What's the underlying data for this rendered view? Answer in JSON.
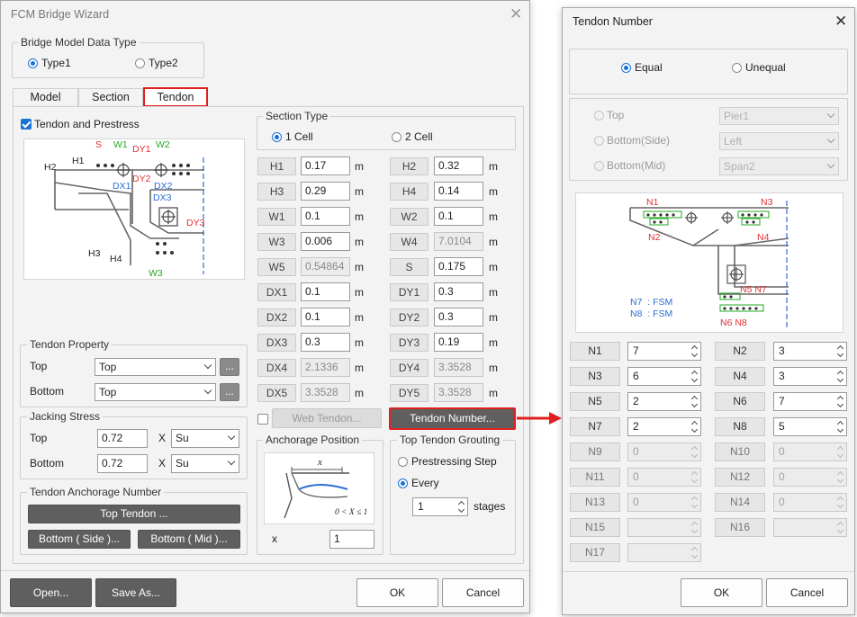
{
  "wizard": {
    "title": "FCM Bridge Wizard",
    "model_type": {
      "legend": "Bridge Model Data Type",
      "options": [
        "Type1",
        "Type2"
      ],
      "selected": "Type1"
    },
    "tabs": [
      "Model",
      "Section",
      "Tendon"
    ],
    "active_tab": "Tendon",
    "tendon_prestress_label": "Tendon and Prestress",
    "diagram_labels": {
      "S": "S",
      "W1": "W1",
      "W2": "W2",
      "W3": "W3",
      "H1": "H1",
      "H2": "H2",
      "H3": "H3",
      "H4": "H4",
      "DX1": "DX1",
      "DX2": "DX2",
      "DX3": "DX3",
      "DY1": "DY1",
      "DY2": "DY2",
      "DY3": "DY3"
    },
    "tendon_property": {
      "legend": "Tendon Property",
      "top_label": "Top",
      "top_value": "Top",
      "bottom_label": "Bottom",
      "bottom_value": "Top",
      "more": "..."
    },
    "jacking_stress": {
      "legend": "Jacking Stress",
      "top_label": "Top",
      "top_value": "0.72",
      "bottom_label": "Bottom",
      "bottom_value": "0.72",
      "x": "X",
      "top_unit": "Su",
      "bottom_unit": "Su"
    },
    "anchorage_number": {
      "legend": "Tendon Anchorage Number",
      "top_button": "Top Tendon ...",
      "bottom_side_button": "Bottom ( Side )...",
      "bottom_mid_button": "Bottom ( Mid )..."
    },
    "section_type": {
      "legend": "Section Type",
      "options": [
        "1 Cell",
        "2 Cell"
      ],
      "selected": "1 Cell"
    },
    "unit": "m",
    "params": [
      {
        "left": {
          "label": "H1",
          "value": "0.17",
          "enabled": true
        },
        "right": {
          "label": "H2",
          "value": "0.32",
          "enabled": true
        }
      },
      {
        "left": {
          "label": "H3",
          "value": "0.29",
          "enabled": true
        },
        "right": {
          "label": "H4",
          "value": "0.14",
          "enabled": true
        }
      },
      {
        "left": {
          "label": "W1",
          "value": "0.1",
          "enabled": true
        },
        "right": {
          "label": "W2",
          "value": "0.1",
          "enabled": true
        }
      },
      {
        "left": {
          "label": "W3",
          "value": "0.006",
          "enabled": true
        },
        "right": {
          "label": "W4",
          "value": "7.0104",
          "enabled": false
        }
      },
      {
        "left": {
          "label": "W5",
          "value": "0.54864",
          "enabled": false
        },
        "right": {
          "label": "S",
          "value": "0.175",
          "enabled": true
        }
      },
      {
        "left": {
          "label": "DX1",
          "value": "0.1",
          "enabled": true
        },
        "right": {
          "label": "DY1",
          "value": "0.3",
          "enabled": true
        }
      },
      {
        "left": {
          "label": "DX2",
          "value": "0.1",
          "enabled": true
        },
        "right": {
          "label": "DY2",
          "value": "0.3",
          "enabled": true
        }
      },
      {
        "left": {
          "label": "DX3",
          "value": "0.3",
          "enabled": true
        },
        "right": {
          "label": "DY3",
          "value": "0.19",
          "enabled": true
        }
      },
      {
        "left": {
          "label": "DX4",
          "value": "2.1336",
          "enabled": false
        },
        "right": {
          "label": "DY4",
          "value": "3.3528",
          "enabled": false
        }
      },
      {
        "left": {
          "label": "DX5",
          "value": "3.3528",
          "enabled": false
        },
        "right": {
          "label": "DY5",
          "value": "3.3528",
          "enabled": false
        }
      }
    ],
    "web_tendon_button": "Web Tendon...",
    "tendon_number_button": "Tendon Number...",
    "anchorage_position": {
      "legend": "Anchorage Position",
      "x_label": "x",
      "x_value": "1",
      "formula": "0 < X ≤ 1",
      "diagram_x": "x"
    },
    "grouting": {
      "legend": "Top Tendon Grouting",
      "options": [
        "Prestressing Step",
        "Every"
      ],
      "selected": "Every",
      "stages_value": "1",
      "stages_label": "stages"
    },
    "footer": {
      "open": "Open...",
      "save_as": "Save As...",
      "ok": "OK",
      "cancel": "Cancel"
    }
  },
  "tendon_dialog": {
    "title": "Tendon Number",
    "mode": {
      "options": [
        "Equal",
        "Unequal"
      ],
      "selected": "Equal"
    },
    "locations": [
      {
        "label": "Top",
        "value": "Pier1"
      },
      {
        "label": "Bottom(Side)",
        "value": "Left"
      },
      {
        "label": "Bottom(Mid)",
        "value": "Span2"
      }
    ],
    "diagram_labels": {
      "N1": "N1",
      "N2": "N2",
      "N3": "N3",
      "N4": "N4",
      "N5N7": "N5 N7",
      "N6N8": "N6 N8",
      "fsm1": "N7  : FSM",
      "fsm2": "N8  : FSM"
    },
    "numbers": [
      {
        "label": "N1",
        "value": "7",
        "enabled": true
      },
      {
        "label": "N2",
        "value": "3",
        "enabled": true
      },
      {
        "label": "N3",
        "value": "6",
        "enabled": true
      },
      {
        "label": "N4",
        "value": "3",
        "enabled": true
      },
      {
        "label": "N5",
        "value": "2",
        "enabled": true
      },
      {
        "label": "N6",
        "value": "7",
        "enabled": true
      },
      {
        "label": "N7",
        "value": "2",
        "enabled": true
      },
      {
        "label": "N8",
        "value": "5",
        "enabled": true
      },
      {
        "label": "N9",
        "value": "0",
        "enabled": false
      },
      {
        "label": "N10",
        "value": "0",
        "enabled": false
      },
      {
        "label": "N11",
        "value": "0",
        "enabled": false
      },
      {
        "label": "N12",
        "value": "0",
        "enabled": false
      },
      {
        "label": "N13",
        "value": "0",
        "enabled": false
      },
      {
        "label": "N14",
        "value": "0",
        "enabled": false
      },
      {
        "label": "N15",
        "value": "",
        "enabled": false
      },
      {
        "label": "N16",
        "value": "",
        "enabled": false
      },
      {
        "label": "N17",
        "value": "",
        "enabled": false
      }
    ],
    "footer": {
      "ok": "OK",
      "cancel": "Cancel"
    }
  },
  "colors": {
    "accent": "#1a73d6",
    "highlight": "#e02020",
    "label_green": "#22aa22",
    "label_red": "#e03030",
    "label_blue": "#2a6fd6"
  }
}
